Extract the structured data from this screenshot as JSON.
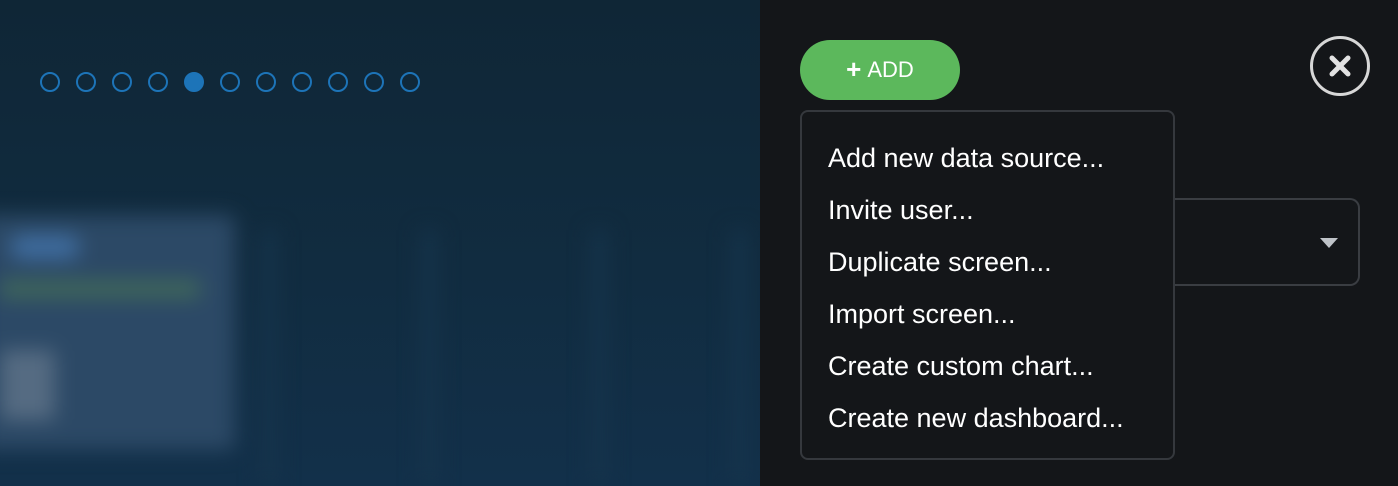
{
  "carousel": {
    "total": 11,
    "active_index": 4
  },
  "toolbar": {
    "add_label": "ADD",
    "add_icon": "plus-icon",
    "add_color": "#5cb85c",
    "close_icon": "close-icon"
  },
  "add_menu": {
    "items": [
      "Add new data source...",
      "Invite user...",
      "Duplicate screen...",
      "Import screen...",
      "Create custom chart...",
      "Create new dashboard..."
    ]
  },
  "colors": {
    "accent": "#1d74b8",
    "panel_bg": "#141619",
    "menu_border": "#35383d"
  }
}
